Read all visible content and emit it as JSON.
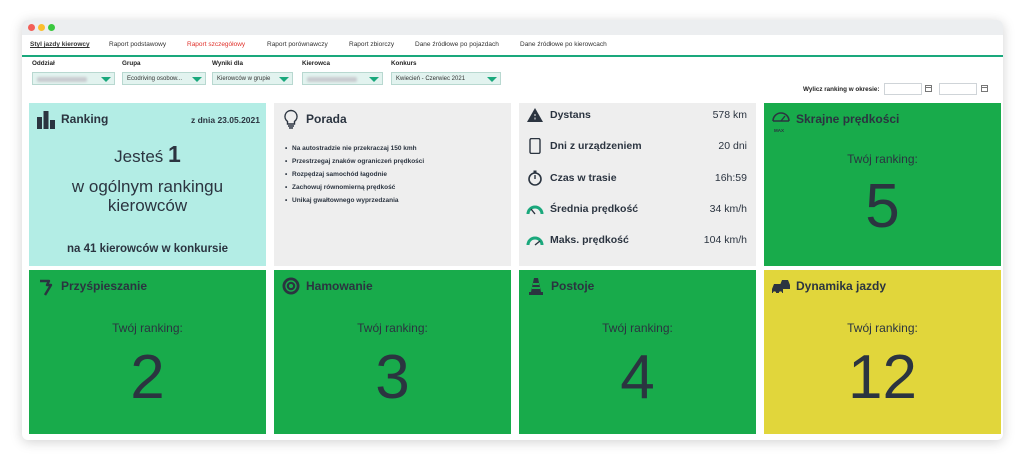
{
  "tabs": [
    {
      "label": "Styl jazdy kierowcy",
      "active": true
    },
    {
      "label": "Raport podstawowy"
    },
    {
      "label": "Raport szczegółowy",
      "color": "#e0312b"
    },
    {
      "label": "Raport porównawczy"
    },
    {
      "label": "Raport zbiorczy"
    },
    {
      "label": "Dane źródłowe po pojazdach"
    },
    {
      "label": "Dane źródłowe po kierowcach"
    }
  ],
  "filters": {
    "oddzial_label": "Oddział",
    "grupa_label": "Grupa",
    "grupa_value": "Ecodriving osobow...",
    "wyniki_label": "Wyniki dla",
    "wyniki_value": "Kierowców w grupie",
    "kierowca_label": "Kierowca",
    "konkurs_label": "Konkurs",
    "konkurs_value": "Kwiecień - Czerwiec 2021",
    "period_label": "Wylicz ranking w okresie:"
  },
  "ranking": {
    "title": "Ranking",
    "date": "z dnia 23.05.2021",
    "line1_prefix": "Jesteś",
    "position": "1",
    "line2": "w ogólnym rankingu",
    "line3": "kierowców",
    "footer": "na 41 kierowców w konkursie"
  },
  "porada": {
    "title": "Porada",
    "tips": [
      "Na autostradzie nie przekraczaj 150 kmh",
      "Przestrzegaj znaków ograniczeń prędkości",
      "Rozpędzaj samochód łagodnie",
      "Zachowuj równomierną prędkość",
      "Unikaj gwałtownego wyprzedzania"
    ]
  },
  "stats": [
    {
      "icon": "road-icon",
      "label": "Dystans",
      "value": "578 km"
    },
    {
      "icon": "phone-device-icon",
      "label": "Dni z urządzeniem",
      "value": "20 dni"
    },
    {
      "icon": "stopwatch-icon",
      "label": "Czas w trasie",
      "value": "16h:59"
    },
    {
      "icon": "speedometer-icon",
      "label": "Średnia prędkość",
      "value": "34 km/h"
    },
    {
      "icon": "speedometer-max-icon",
      "label": "Maks. prędkość",
      "value": "104 km/h"
    }
  ],
  "cards": {
    "skrajne": {
      "title": "Skrajne prędkości",
      "icon_caption": "MAX",
      "sub": "Twój ranking:",
      "value": "5"
    },
    "przyspieszanie": {
      "title": "Przyśpieszanie",
      "sub": "Twój ranking:",
      "value": "2"
    },
    "hamowanie": {
      "title": "Hamowanie",
      "sub": "Twój ranking:",
      "value": "3"
    },
    "postoje": {
      "title": "Postoje",
      "sub": "Twój ranking:",
      "value": "4"
    },
    "dynamika": {
      "title": "Dynamika jazdy",
      "sub": "Twój ranking:",
      "value": "12"
    }
  },
  "colors": {
    "accent": "#1aa87c",
    "green_card": "#18ab4b",
    "yellow_card": "#e1d63b",
    "mint_card": "#b3ede5",
    "grey_card": "#eeeeee",
    "active_tab_red": "#e0312b"
  }
}
